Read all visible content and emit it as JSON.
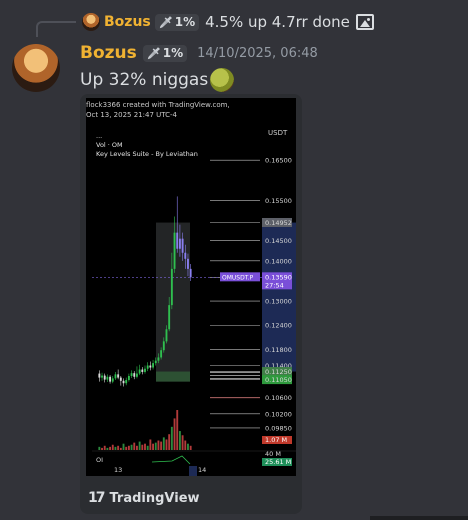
{
  "reply": {
    "username": "Bozus",
    "tag_label": "1%",
    "text": "4.5% up  4.7rr done"
  },
  "message": {
    "username": "Bozus",
    "tag_label": "1%",
    "timestamp": "14/10/2025, 06:48",
    "text": "Up 32% niggas"
  },
  "attachment": {
    "credit_line1": "flock3366 created with TradingView.com,",
    "credit_line2": "Oct 13, 2025 21:47 UTC-4",
    "footer_brand": "TradingView"
  },
  "chart_data": {
    "type": "candlestick",
    "currency_label": "USDT",
    "legend": [
      "...",
      "Vol · OM",
      "Key Levels Suite - By Leviathan"
    ],
    "symbol_label": "OMUSDT.P",
    "last_price": "0.13590",
    "countdown": "27:54",
    "price_ticks": [
      "0.16500",
      "0.15500",
      "0.14952",
      "0.14500",
      "0.14000",
      "0.13590",
      "0.13000",
      "0.12400",
      "0.11800",
      "0.11400",
      "0.11250",
      "0.11050",
      "0.10600",
      "0.10200",
      "0.09850"
    ],
    "highlighted_prices": {
      "0.14952": "#5d6068",
      "0.11250": "#3f7f47",
      "0.11050": "#2e9a3d"
    },
    "ylim": [
      0.0955,
      0.171
    ],
    "x_tick_labels": [
      "13",
      "14"
    ],
    "volume_label": "1.07 M",
    "oi_label": "OI",
    "oi_values": [
      "40 M",
      "25.61 M"
    ],
    "candles": [
      [
        0.112,
        0.111,
        0.1128,
        0.11
      ],
      [
        0.111,
        0.1115,
        0.1122,
        0.1102
      ],
      [
        0.1115,
        0.1105,
        0.112,
        0.1098
      ],
      [
        0.1105,
        0.1112,
        0.1118,
        0.1099
      ],
      [
        0.1112,
        0.11,
        0.1116,
        0.1095
      ],
      [
        0.11,
        0.1108,
        0.1114,
        0.1096
      ],
      [
        0.1108,
        0.1118,
        0.1124,
        0.1104
      ],
      [
        0.1118,
        0.111,
        0.113,
        0.1106
      ],
      [
        0.111,
        0.1102,
        0.1114,
        0.109
      ],
      [
        0.1102,
        0.1096,
        0.1108,
        0.1088
      ],
      [
        0.1096,
        0.1104,
        0.111,
        0.1091
      ],
      [
        0.1104,
        0.1114,
        0.112,
        0.11
      ],
      [
        0.1114,
        0.1121,
        0.1128,
        0.1109
      ],
      [
        0.1121,
        0.1112,
        0.1126,
        0.1106
      ],
      [
        0.1112,
        0.112,
        0.1138,
        0.1108
      ],
      [
        0.112,
        0.113,
        0.1142,
        0.1116
      ],
      [
        0.113,
        0.1124,
        0.1136,
        0.1118
      ],
      [
        0.1124,
        0.1132,
        0.114,
        0.112
      ],
      [
        0.1132,
        0.114,
        0.1148,
        0.1126
      ],
      [
        0.114,
        0.1135,
        0.115,
        0.1128
      ],
      [
        0.1135,
        0.1146,
        0.1154,
        0.113
      ],
      [
        0.1146,
        0.1152,
        0.116,
        0.114
      ],
      [
        0.1152,
        0.116,
        0.117,
        0.1146
      ],
      [
        0.116,
        0.1178,
        0.1185,
        0.1155
      ],
      [
        0.1178,
        0.12,
        0.121,
        0.1172
      ],
      [
        0.12,
        0.123,
        0.124,
        0.1195
      ],
      [
        0.123,
        0.129,
        0.131,
        0.1225
      ],
      [
        0.129,
        0.138,
        0.142,
        0.128
      ],
      [
        0.138,
        0.147,
        0.151,
        0.137
      ],
      [
        0.147,
        0.143,
        0.156,
        0.142
      ],
      [
        0.143,
        0.1455,
        0.149,
        0.141
      ],
      [
        0.1455,
        0.142,
        0.147,
        0.14
      ],
      [
        0.142,
        0.1405,
        0.144,
        0.138
      ],
      [
        0.1405,
        0.138,
        0.1418,
        0.1362
      ],
      [
        0.138,
        0.1359,
        0.1392,
        0.135
      ]
    ],
    "volumes": [
      3,
      2,
      4,
      2,
      3,
      5,
      3,
      4,
      2,
      6,
      3,
      4,
      5,
      7,
      4,
      8,
      5,
      6,
      4,
      10,
      6,
      7,
      9,
      8,
      12,
      10,
      15,
      22,
      30,
      38,
      18,
      14,
      9,
      6,
      4
    ]
  }
}
